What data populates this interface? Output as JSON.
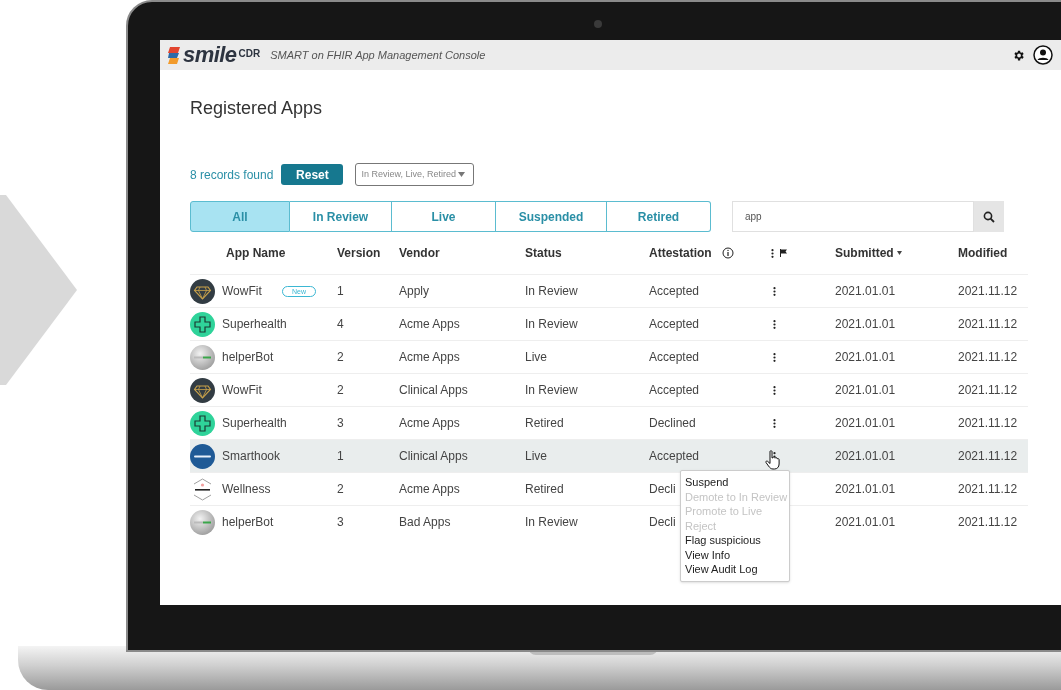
{
  "header": {
    "brand": "smile",
    "brand_suffix": "CDR",
    "subtitle": "SMART on FHIR App Management Console"
  },
  "page_title": "Registered Apps",
  "filters": {
    "count": "8 records found",
    "reset": "Reset",
    "status_filter": "In Review, Live, Retired"
  },
  "tabs": [
    {
      "label": "All",
      "selected": true
    },
    {
      "label": "In Review",
      "selected": false
    },
    {
      "label": "Live",
      "selected": false
    },
    {
      "label": "Suspended",
      "selected": false
    },
    {
      "label": "Retired",
      "selected": false
    }
  ],
  "search": {
    "value": "app"
  },
  "table": {
    "columns": [
      {
        "kind": "plain",
        "label": "App Name"
      },
      {
        "kind": "plain",
        "label": "Version"
      },
      {
        "kind": "plain",
        "label": "Vendor"
      },
      {
        "kind": "plain",
        "label": "Status"
      },
      {
        "kind": "info",
        "label": "Attestation"
      },
      {
        "kind": "actions"
      },
      {
        "kind": "sorted",
        "label": "Submitted"
      },
      {
        "kind": "plain",
        "label": "Modified"
      }
    ],
    "rows": [
      {
        "kind": "gem",
        "name": "WowFit",
        "badge": "New",
        "version": "1",
        "vendor": "Apply",
        "status": "In Review",
        "attestation": "Accepted",
        "submitted": "2021.01.01",
        "modified": "2021.11.12",
        "selected": false
      },
      {
        "kind": "cross",
        "name": "Superhealth",
        "version": "4",
        "vendor": "Acme Apps",
        "status": "In Review",
        "attestation": "Accepted",
        "submitted": "2021.01.01",
        "modified": "2021.11.12",
        "selected": false
      },
      {
        "kind": "bot",
        "name": "helperBot",
        "version": "2",
        "vendor": "Acme Apps",
        "status": "Live",
        "attestation": "Accepted",
        "submitted": "2021.01.01",
        "modified": "2021.11.12",
        "selected": false
      },
      {
        "kind": "gem",
        "name": "WowFit",
        "version": "2",
        "vendor": "Clinical Apps",
        "status": "In Review",
        "attestation": "Accepted",
        "submitted": "2021.01.01",
        "modified": "2021.11.12",
        "selected": false
      },
      {
        "kind": "cross",
        "name": "Superhealth",
        "version": "3",
        "vendor": "Acme Apps",
        "status": "Retired",
        "attestation": "Declined",
        "submitted": "2021.01.01",
        "modified": "2021.11.12",
        "selected": false
      },
      {
        "kind": "hook",
        "name": "Smarthook",
        "version": "1",
        "vendor": "Clinical Apps",
        "status": "Live",
        "attestation": "Accepted",
        "submitted": "2021.01.01",
        "modified": "2021.11.12",
        "selected": true
      },
      {
        "kind": "hexagon",
        "name": "Wellness",
        "version": "2",
        "vendor": "Acme Apps",
        "status": "Retired",
        "attestation": "Decli",
        "submitted": "2021.01.01",
        "modified": "2021.11.12",
        "selected": false
      },
      {
        "kind": "bot",
        "name": "helperBot",
        "version": "3",
        "vendor": "Bad Apps",
        "status": "In Review",
        "attestation": "Decli",
        "submitted": "2021.01.01",
        "modified": "2021.11.12",
        "selected": false
      }
    ]
  },
  "row_menu": {
    "items": [
      {
        "label": "Suspend",
        "disabled": false
      },
      {
        "label": "Demote to In Review",
        "disabled": true
      },
      {
        "label": "Promote to Live",
        "disabled": true
      },
      {
        "label": "Reject",
        "disabled": true
      },
      {
        "label": "Flag suspicious",
        "disabled": false
      },
      {
        "label": "View Info",
        "disabled": false
      },
      {
        "label": "View Audit Log",
        "disabled": false
      }
    ]
  }
}
